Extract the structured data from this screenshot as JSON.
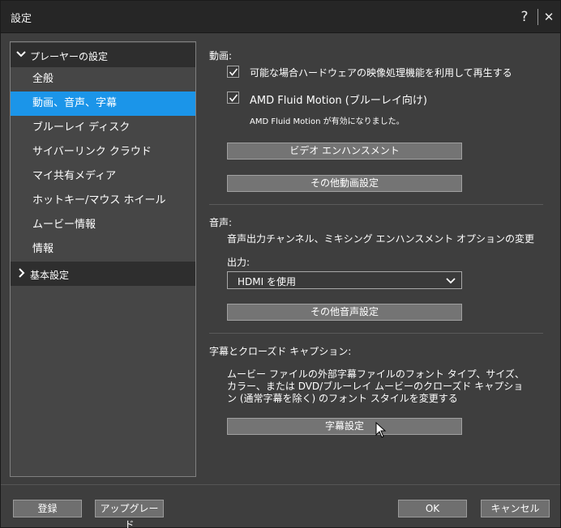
{
  "window": {
    "title": "設定",
    "help_glyph": "?",
    "close_glyph": "✕"
  },
  "sidebar": {
    "groups": [
      {
        "label": "プレーヤーの設定",
        "expanded": true,
        "icon": "chevron-down-icon"
      },
      {
        "label": "基本設定",
        "expanded": false,
        "icon": "chevron-right-icon"
      }
    ],
    "items": [
      {
        "label": "全般"
      },
      {
        "label": "動画、音声、字幕",
        "selected": true
      },
      {
        "label": "ブルーレイ ディスク"
      },
      {
        "label": "サイバーリンク クラウド"
      },
      {
        "label": "マイ共有メディア"
      },
      {
        "label": "ホットキー/マウス ホイール"
      },
      {
        "label": "ムービー情報"
      },
      {
        "label": "情報"
      }
    ]
  },
  "video": {
    "title": "動画:",
    "hw_accel": {
      "label": "可能な場合ハードウェアの映像処理機能を利用して再生する",
      "checked": true
    },
    "fluid_motion": {
      "label": "AMD Fluid Motion (ブルーレイ向け)",
      "checked": true
    },
    "fluid_note": "AMD Fluid Motion が有効になりました。",
    "enhance_button": "ビデオ エンハンスメント",
    "more_button": "その他動画設定"
  },
  "audio": {
    "title": "音声:",
    "description": "音声出力チャンネル、ミキシング エンハンスメント オプションの変更",
    "output_label": "出力:",
    "output_value": "HDMI を使用",
    "more_button": "その他音声設定"
  },
  "subtitles": {
    "title": "字幕とクローズド キャプション:",
    "description": "ムービー ファイルの外部字幕ファイルのフォント タイプ、サイズ、カラー、または DVD/ブルーレイ ムービーのクローズド キャプション (通常字幕を除く) のフォント スタイルを変更する",
    "button": "字幕設定"
  },
  "footer": {
    "register": "登録",
    "upgrade": "アップグレード",
    "ok": "OK",
    "cancel": "キャンセル"
  },
  "colors": {
    "accent": "#1b95e9",
    "background": "#3e3e3e",
    "button": "#747474"
  }
}
